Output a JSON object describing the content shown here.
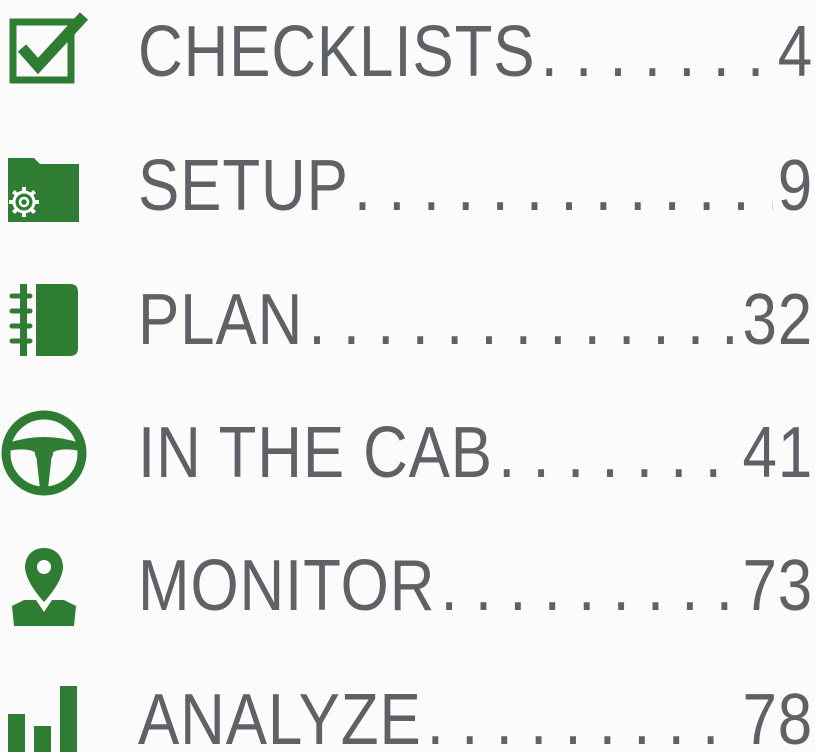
{
  "toc": {
    "accent_color": "#2e7d32",
    "text_color": "#5e6266",
    "items": [
      {
        "label": "CHECKLISTS",
        "page": "4",
        "icon": "checkbox-icon"
      },
      {
        "label": "SETUP",
        "page": "9",
        "icon": "folder-gear-icon"
      },
      {
        "label": "PLAN",
        "page": "32",
        "icon": "notebook-icon"
      },
      {
        "label": "IN THE CAB",
        "page": "41",
        "icon": "steering-wheel-icon"
      },
      {
        "label": "MONITOR",
        "page": "73",
        "icon": "map-pin-icon"
      },
      {
        "label": "ANALYZE",
        "page": "78",
        "icon": "bar-chart-icon"
      }
    ]
  }
}
